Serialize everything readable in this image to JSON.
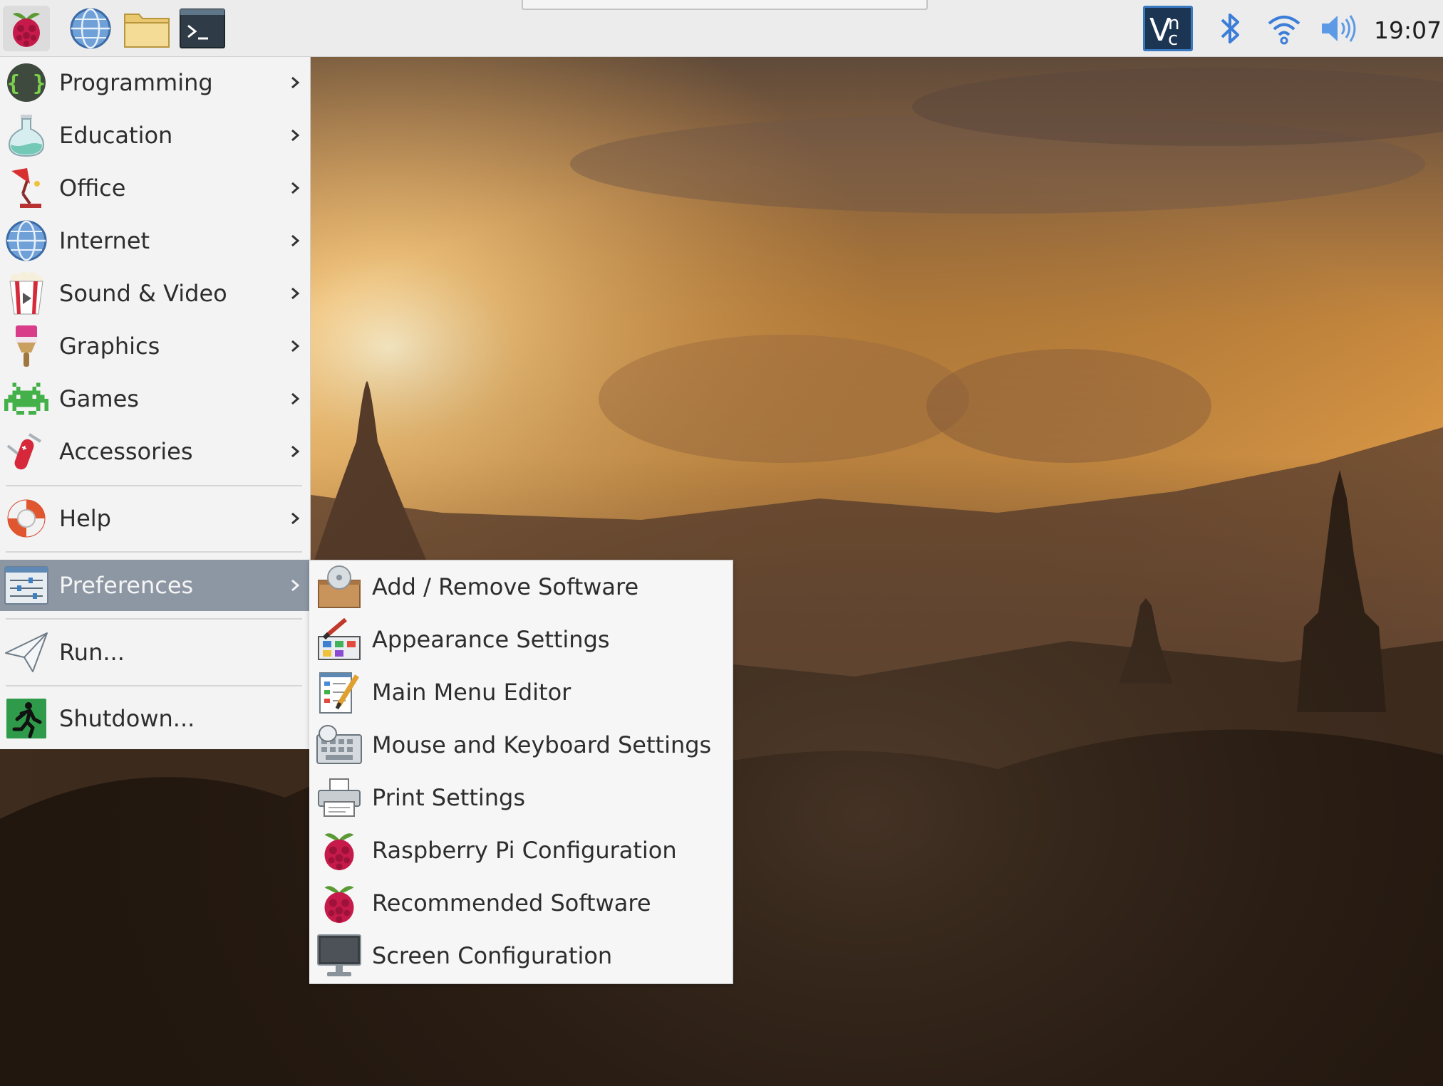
{
  "desktop": {
    "wallpaper": "sunset-over-temples"
  },
  "panel": {
    "launchers": [
      {
        "name": "raspberry-menu",
        "icon": "raspberry-icon"
      },
      {
        "name": "web-browser",
        "icon": "globe-icon"
      },
      {
        "name": "file-manager",
        "icon": "folder-icon"
      },
      {
        "name": "terminal",
        "icon": "terminal-icon"
      }
    ],
    "terminal_prompt": ">_",
    "tray": {
      "vnc_label": "Vε",
      "bluetooth": "bluetooth-icon",
      "wifi": "wifi-icon",
      "volume": "volume-icon"
    },
    "clock": "19:07"
  },
  "menu": {
    "items": [
      {
        "label": "Programming",
        "icon": "braces-icon",
        "has_submenu": true
      },
      {
        "label": "Education",
        "icon": "flask-icon",
        "has_submenu": true
      },
      {
        "label": "Office",
        "icon": "desk-lamp-icon",
        "has_submenu": true
      },
      {
        "label": "Internet",
        "icon": "globe-icon",
        "has_submenu": true
      },
      {
        "label": "Sound & Video",
        "icon": "popcorn-icon",
        "has_submenu": true
      },
      {
        "label": "Graphics",
        "icon": "paintbrush-icon",
        "has_submenu": true
      },
      {
        "label": "Games",
        "icon": "space-invader-icon",
        "has_submenu": true
      },
      {
        "label": "Accessories",
        "icon": "pocket-knife-icon",
        "has_submenu": true
      },
      {
        "label": "Help",
        "icon": "lifebuoy-icon",
        "has_submenu": true
      },
      {
        "label": "Preferences",
        "icon": "preferences-icon",
        "has_submenu": true,
        "active": true
      },
      {
        "label": "Run...",
        "icon": "paper-plane-icon",
        "has_submenu": false
      },
      {
        "label": "Shutdown...",
        "icon": "exit-icon",
        "has_submenu": false
      }
    ],
    "active_color": "#8d97a4"
  },
  "submenu": {
    "items": [
      {
        "label": "Add / Remove Software",
        "icon": "package-icon"
      },
      {
        "label": "Appearance Settings",
        "icon": "palette-icon"
      },
      {
        "label": "Main Menu Editor",
        "icon": "menu-editor-icon"
      },
      {
        "label": "Mouse and Keyboard Settings",
        "icon": "keyboard-icon"
      },
      {
        "label": "Print Settings",
        "icon": "printer-icon"
      },
      {
        "label": "Raspberry Pi Configuration",
        "icon": "raspberry-icon"
      },
      {
        "label": "Recommended Software",
        "icon": "raspberry-icon"
      },
      {
        "label": "Screen Configuration",
        "icon": "monitor-icon"
      }
    ]
  }
}
